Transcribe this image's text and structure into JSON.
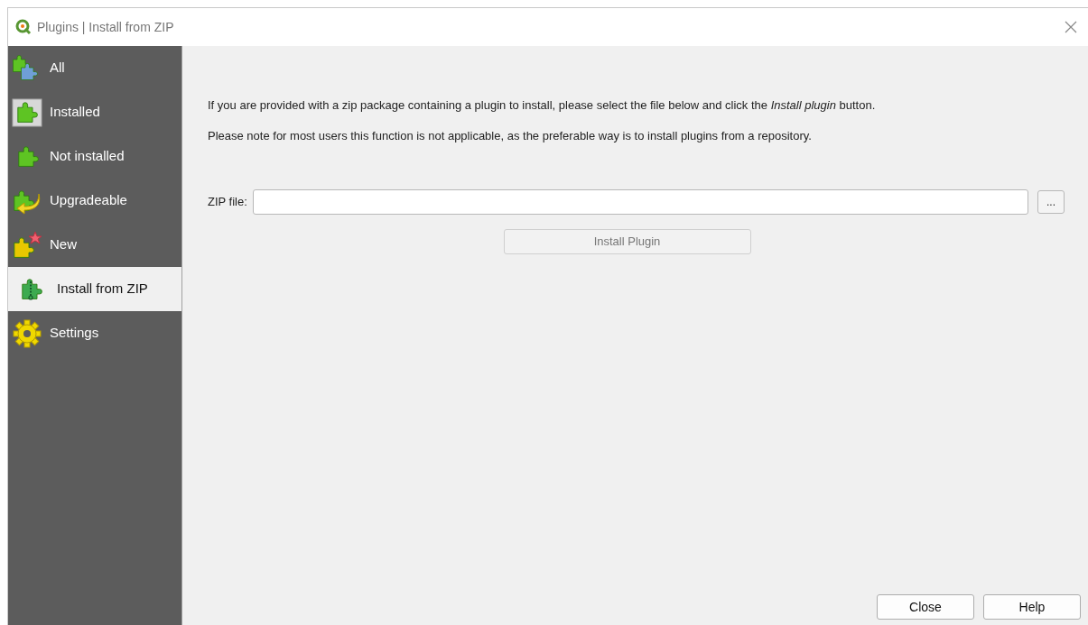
{
  "window": {
    "title": "Plugins | Install from ZIP"
  },
  "sidebar": {
    "items": [
      {
        "label": "All",
        "kind": "all",
        "selected": false
      },
      {
        "label": "Installed",
        "kind": "installed",
        "selected": false
      },
      {
        "label": "Not installed",
        "kind": "not_installed",
        "selected": false
      },
      {
        "label": "Upgradeable",
        "kind": "upgradeable",
        "selected": false
      },
      {
        "label": "New",
        "kind": "new",
        "selected": false
      },
      {
        "label": "Install from ZIP",
        "kind": "zip",
        "selected": true
      },
      {
        "label": "Settings",
        "kind": "settings",
        "selected": false
      }
    ]
  },
  "content": {
    "paragraphs": [
      "If you are provided with a zip package containing a plugin to install, please select the file below and click the *Install plugin* button.",
      "Please note for most users this function is not applicable, as the preferable way is to install plugins from a repository."
    ],
    "zip_field": {
      "label": "ZIP file:",
      "browse": "..."
    },
    "install_button": {
      "label": "Install Plugin",
      "disabled": true
    }
  },
  "buttons": [
    "Close",
    "Help"
  ]
}
